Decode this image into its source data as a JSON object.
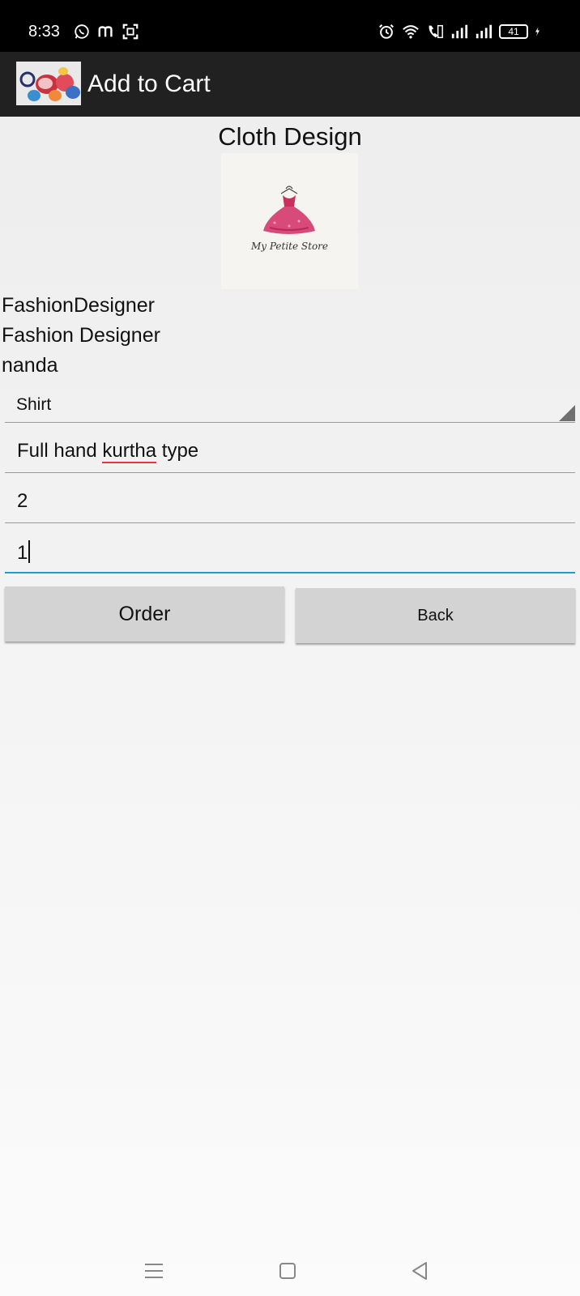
{
  "status_bar": {
    "time": "8:33",
    "left_icons": [
      "whatsapp-icon",
      "m-app-icon",
      "focus-icon"
    ],
    "right_icons": [
      "alarm-icon",
      "wifi-icon",
      "volte-call-icon",
      "signal-icon",
      "signal-icon"
    ],
    "battery_level": "41",
    "charging": true
  },
  "action_bar": {
    "title": "Add to Cart",
    "icon": "clothes-app-icon"
  },
  "main": {
    "heading": "Cloth Design",
    "logo_text": "My Petite Store",
    "info_lines": [
      "FashionDesigner",
      "Fashion Designer",
      "nanda"
    ],
    "spinner": {
      "selected": "Shirt"
    },
    "fields": {
      "description_prefix": "Full hand ",
      "description_misspelled": "kurtha",
      "description_suffix": " type",
      "field_two": "2",
      "field_three": "1"
    },
    "buttons": {
      "order_label": "Order",
      "back_label": "Back"
    }
  },
  "nav_bar": {
    "icons": [
      "menu-icon",
      "home-icon",
      "back-icon"
    ]
  },
  "colors": {
    "status_bar": "#000000",
    "action_bar": "#212121",
    "focus_accent": "#1e9fc9",
    "button_bg": "#d3d3d3",
    "spell_underline": "#e0383e",
    "dress_pink": "#d84a7a"
  }
}
